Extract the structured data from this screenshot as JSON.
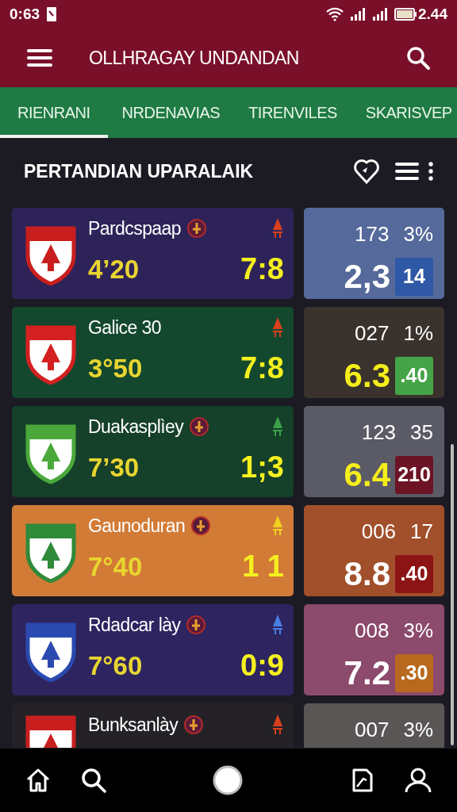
{
  "status_bar": {
    "time": "0:63",
    "battery_text": "2.44"
  },
  "app_bar": {
    "title": "OLLHRAGAY UNDANDAN"
  },
  "tabs": [
    {
      "label": "RIENRANI",
      "selected": true
    },
    {
      "label": "NRDENAVIAS",
      "selected": false
    },
    {
      "label": "TIRENVILES",
      "selected": false
    },
    {
      "label": "SKARISVEP",
      "selected": false
    }
  ],
  "section": {
    "title": "PERTANDIAN UPARALAIK"
  },
  "matches": [
    {
      "team": "Pardcspaap",
      "emblem": true,
      "time": "4’20",
      "score": "7:8",
      "color": "#2e2358",
      "crest": {
        "color": "#c81e1e"
      },
      "marker": {
        "color": "#d8401e"
      },
      "stats": {
        "color": "#55699a",
        "stat_1": "173",
        "stat_2": "3%",
        "value": "2,3",
        "value_highlight": false,
        "badge": {
          "text": "14",
          "color": "#2f58a6"
        }
      }
    },
    {
      "team": "Galice 30",
      "emblem": false,
      "time": "3°50",
      "score": "7:8",
      "color": "#14482e",
      "crest": {
        "color": "#d42020"
      },
      "marker": {
        "color": "#d8401e"
      },
      "stats": {
        "color": "#3a322d",
        "stat_1": "027",
        "stat_2": "1%",
        "value": "6.3",
        "value_highlight": true,
        "badge": {
          "text": ".40",
          "color": "#44a447"
        }
      }
    },
    {
      "team": "Duakasplìey",
      "emblem": true,
      "time": "7’30",
      "score": "1;3",
      "color": "#15402a",
      "crest": {
        "color": "#4aa83a"
      },
      "marker": {
        "color": "#3aa04a"
      },
      "stats": {
        "color": "#5b5b68",
        "stat_1": "123",
        "stat_2": "35",
        "value": "6.4",
        "value_highlight": true,
        "badge": {
          "text": "210",
          "color": "#6c1426"
        }
      }
    },
    {
      "team": "Gaunoduran",
      "emblem": true,
      "time": "7°40",
      "score": "1 1",
      "color": "#d27b36",
      "crest": {
        "color": "#2f8a3a"
      },
      "marker": {
        "color": "#f0d020"
      },
      "stats": {
        "color": "#a24f2b",
        "stat_1": "006",
        "stat_2": "17",
        "value": "8.8",
        "value_highlight": false,
        "badge": {
          "text": ".40",
          "color": "#8c1414"
        }
      }
    },
    {
      "team": "Rdadcar lày",
      "emblem": true,
      "time": "7°60",
      "score": "0:9",
      "color": "#2d2460",
      "crest": {
        "color": "#2a4ab0"
      },
      "marker": {
        "color": "#4a7ee0"
      },
      "stats": {
        "color": "#8c4a6c",
        "stat_1": "008",
        "stat_2": "3%",
        "value": "7.2",
        "value_highlight": false,
        "badge": {
          "text": ".30",
          "color": "#b8691e"
        }
      }
    },
    {
      "team": "Bunksanlày",
      "emblem": true,
      "color": "#242226",
      "crest": {
        "color": "#c81e1e"
      },
      "marker": {
        "color": "#d8401e"
      },
      "stats": {
        "color": "#5a5656",
        "stat_1": "007",
        "stat_2": "3%"
      }
    }
  ]
}
